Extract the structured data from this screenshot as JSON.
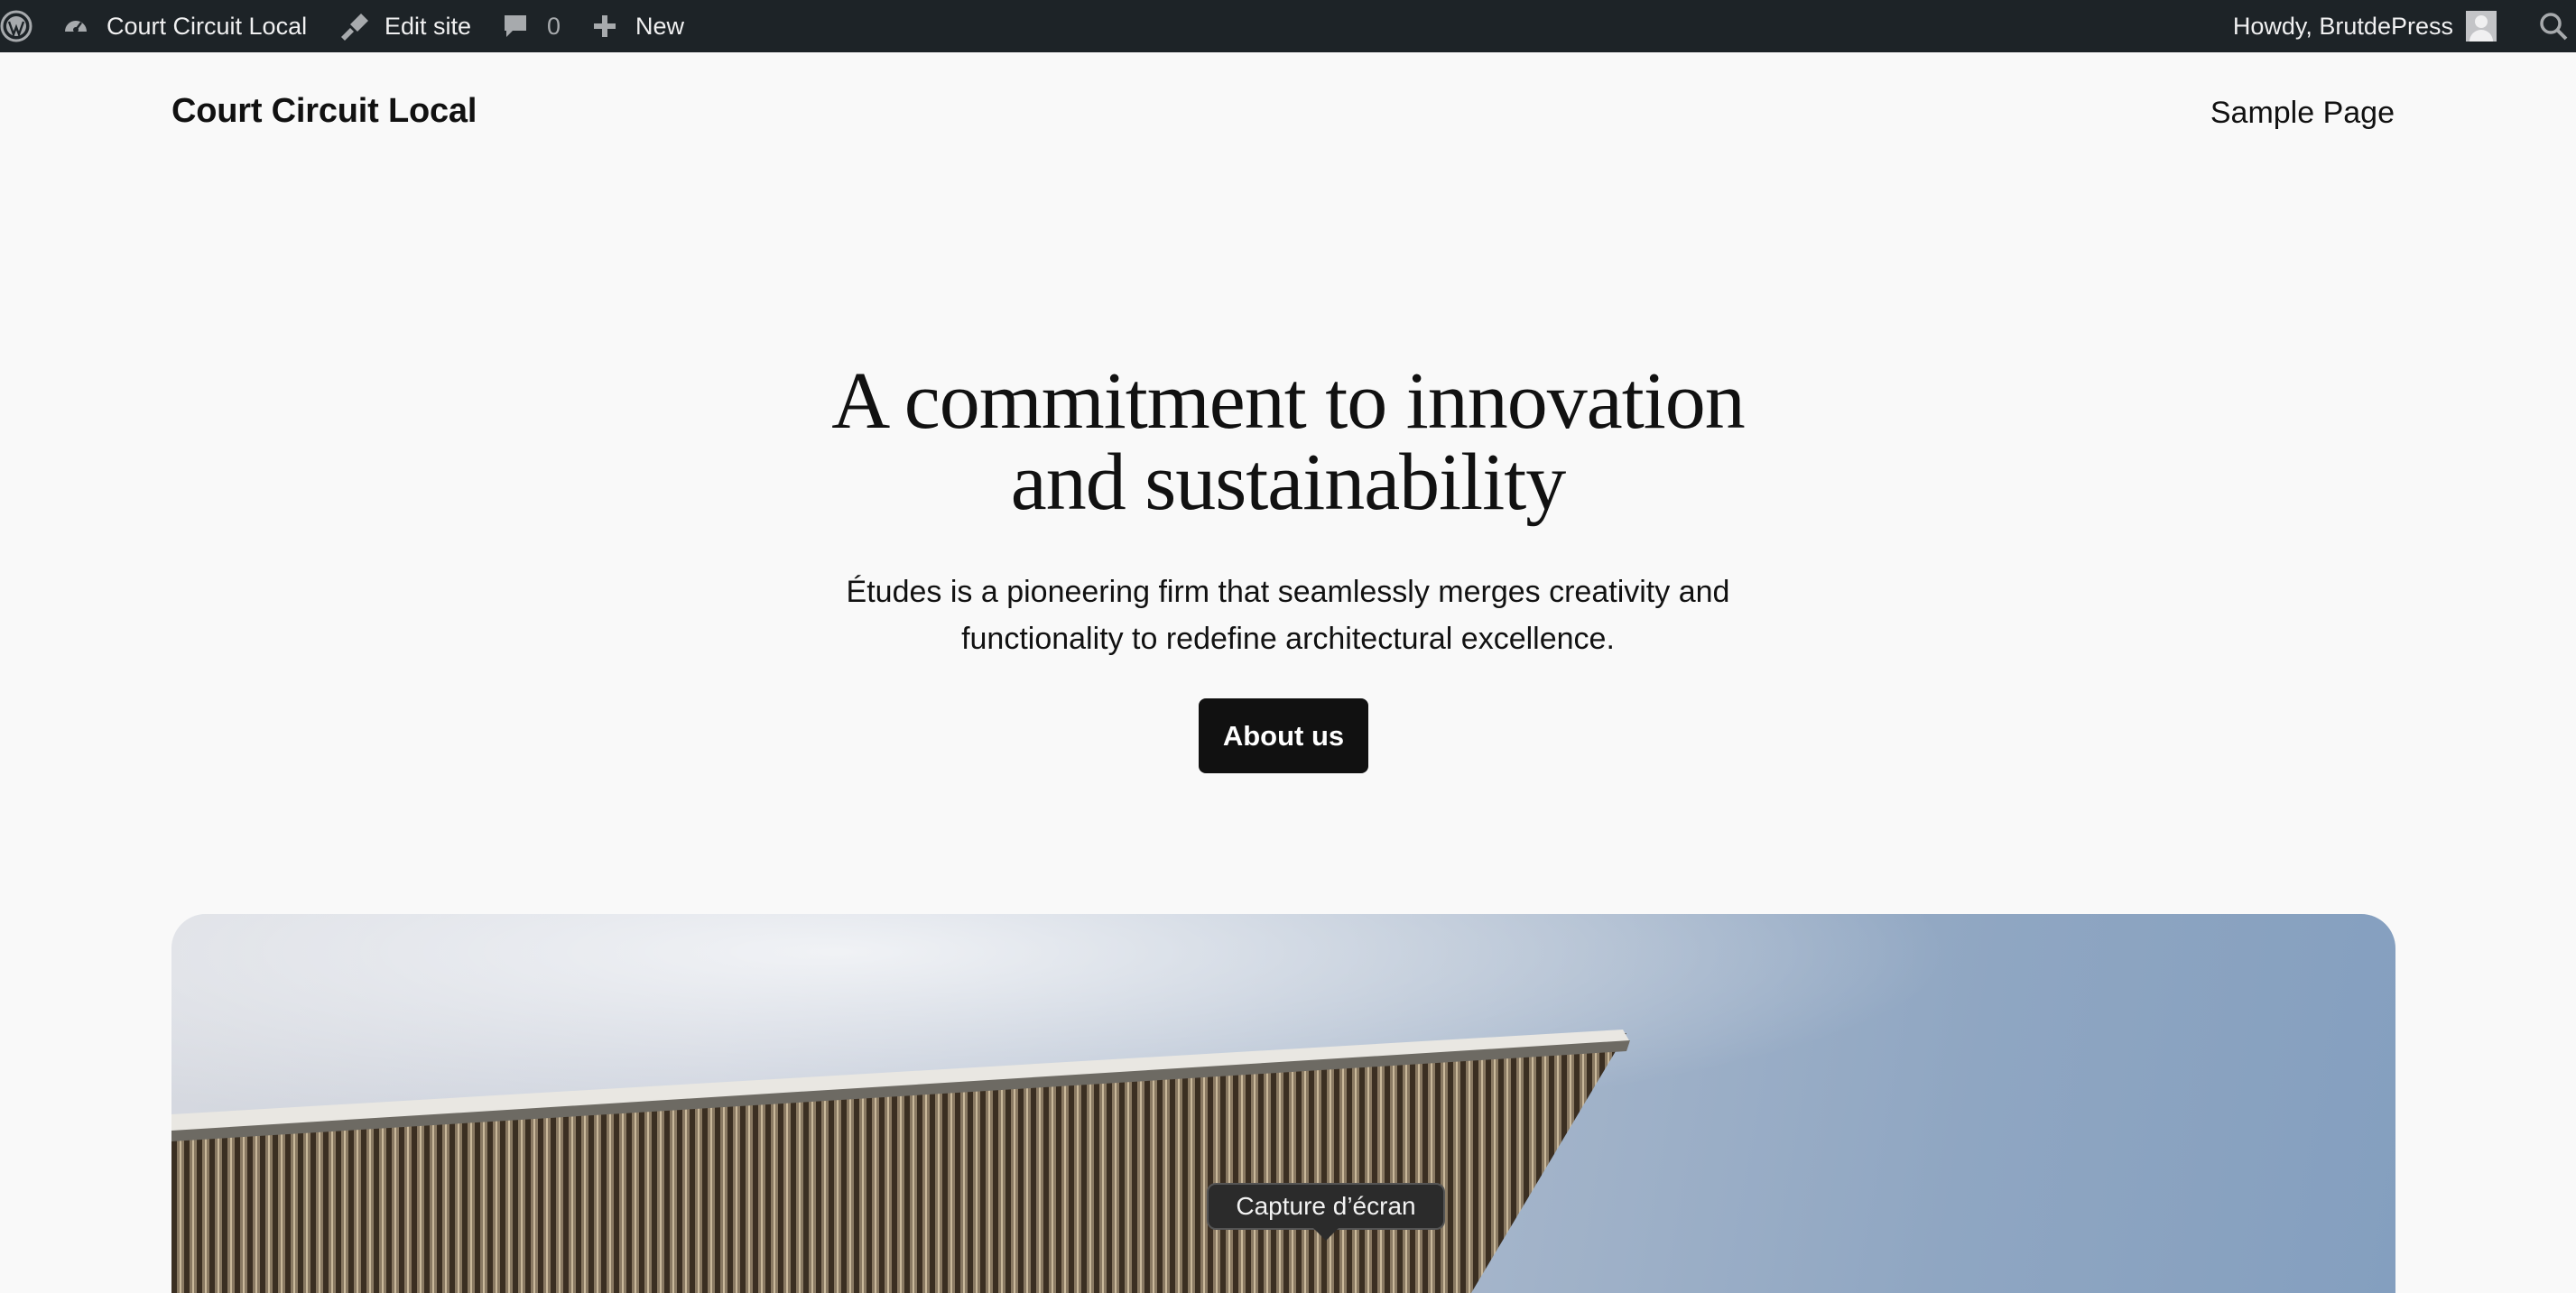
{
  "admin_bar": {
    "site_name": "Court Circuit Local",
    "edit_site": "Edit site",
    "comments_count": "0",
    "new_label": "New",
    "howdy": "Howdy, BrutdePress",
    "icons": [
      "wordpress-logo-icon",
      "dashboard-icon",
      "brush-icon",
      "comment-icon",
      "plus-icon",
      "avatar",
      "search-icon"
    ]
  },
  "header": {
    "site_title": "Court Circuit Local",
    "nav": [
      "Sample Page"
    ]
  },
  "hero": {
    "heading_lines": [
      "A commitment to innovation",
      "and sustainability"
    ],
    "subtitle_lines": [
      "Études is a pioneering firm that seamlessly merges creativity and",
      "functionality to redefine architectural excellence."
    ],
    "button_label": "About us"
  },
  "tooltip": {
    "text": "Capture d’écran"
  },
  "colors": {
    "admin_bar_bg": "#1d2327",
    "page_bg": "#f9f9f9",
    "button_bg": "#111111",
    "text": "#111111"
  }
}
